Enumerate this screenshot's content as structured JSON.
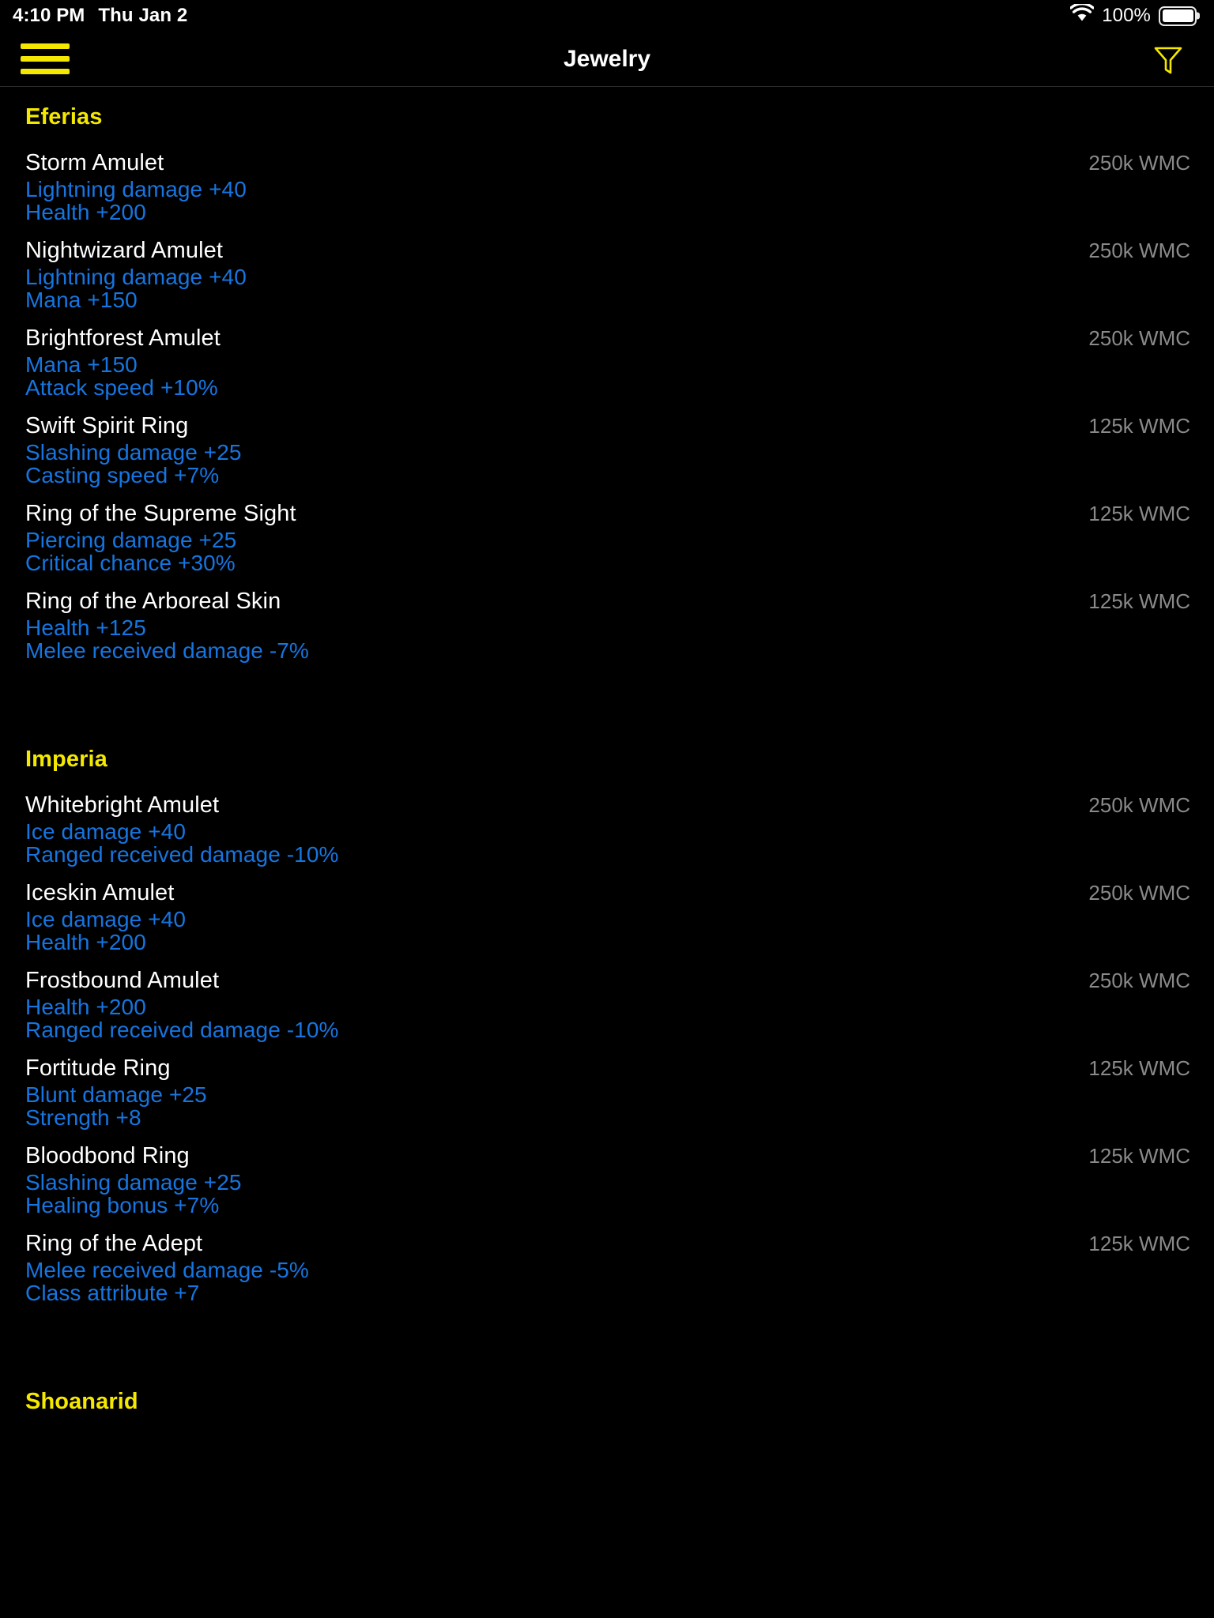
{
  "status_bar": {
    "time": "4:10 PM",
    "date": "Thu Jan 2",
    "wifi_icon": "wifi-icon",
    "battery_percent": "100%",
    "battery_icon": "battery-full-icon"
  },
  "nav_bar": {
    "menu_icon": "hamburger-menu-icon",
    "title": "Jewelry",
    "filter_icon": "funnel-filter-icon",
    "accent_color": "#f5e800"
  },
  "colors": {
    "background": "#000000",
    "section_header": "#f5e800",
    "item_name": "#ffffff",
    "item_stat": "#1675e0",
    "item_price": "#8a8a8a"
  },
  "sections": [
    {
      "title": "Eferias",
      "items": [
        {
          "name": "Storm Amulet",
          "price": "250k WMC",
          "stats": [
            "Lightning damage +40",
            "Health +200"
          ]
        },
        {
          "name": "Nightwizard Amulet",
          "price": "250k WMC",
          "stats": [
            "Lightning damage +40",
            "Mana +150"
          ]
        },
        {
          "name": "Brightforest Amulet",
          "price": "250k WMC",
          "stats": [
            "Mana +150",
            "Attack speed +10%"
          ]
        },
        {
          "name": "Swift Spirit Ring",
          "price": "125k WMC",
          "stats": [
            "Slashing damage +25",
            "Casting speed +7%"
          ]
        },
        {
          "name": "Ring of the Supreme Sight",
          "price": "125k WMC",
          "stats": [
            "Piercing damage +25",
            "Critical chance +30%"
          ]
        },
        {
          "name": "Ring of the Arboreal Skin",
          "price": "125k WMC",
          "stats": [
            "Health +125",
            "Melee received damage -7%"
          ]
        }
      ]
    },
    {
      "title": "Imperia",
      "items": [
        {
          "name": "Whitebright Amulet",
          "price": "250k WMC",
          "stats": [
            "Ice damage +40",
            "Ranged received damage -10%"
          ]
        },
        {
          "name": "Iceskin Amulet",
          "price": "250k WMC",
          "stats": [
            "Ice damage +40",
            "Health +200"
          ]
        },
        {
          "name": "Frostbound Amulet",
          "price": "250k WMC",
          "stats": [
            "Health +200",
            "Ranged received damage -10%"
          ]
        },
        {
          "name": "Fortitude Ring",
          "price": "125k WMC",
          "stats": [
            "Blunt damage +25",
            "Strength +8"
          ]
        },
        {
          "name": "Bloodbond Ring",
          "price": "125k WMC",
          "stats": [
            "Slashing damage +25",
            "Healing bonus +7%"
          ]
        },
        {
          "name": "Ring of the Adept",
          "price": "125k WMC",
          "stats": [
            "Melee received damage -5%",
            "Class attribute +7"
          ]
        }
      ]
    },
    {
      "title": "Shoanarid",
      "items": []
    }
  ]
}
